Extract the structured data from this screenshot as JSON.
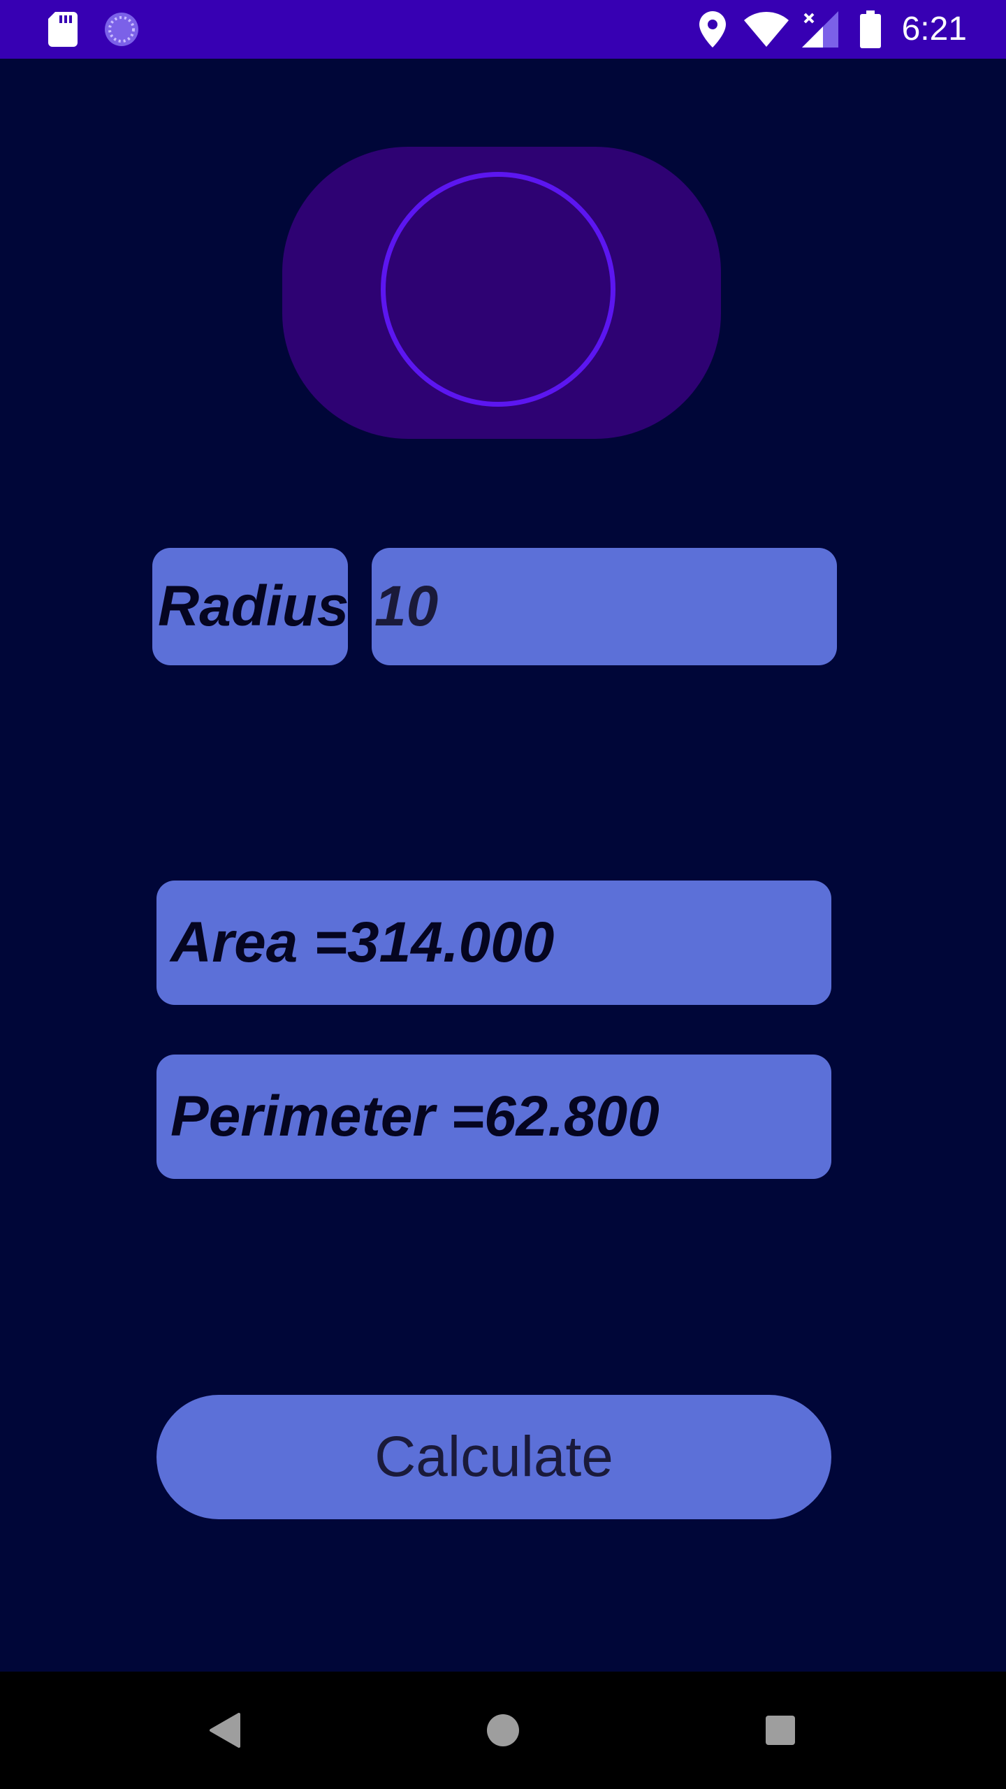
{
  "status_bar": {
    "time": "6:21",
    "left_icons": [
      "sd-card-icon",
      "sync-icon"
    ],
    "right_icons": [
      "location-icon",
      "wifi-icon",
      "cell-signal-icon",
      "battery-icon"
    ]
  },
  "logo": {
    "icon": "circle-icon"
  },
  "form": {
    "radius_label": "Radius",
    "radius_value": "10"
  },
  "results": {
    "area": "Area =314.000",
    "perimeter": "Perimeter =62.800"
  },
  "actions": {
    "calculate_label": "Calculate"
  },
  "nav_bar": {
    "buttons": [
      "back-icon",
      "home-icon",
      "recents-icon"
    ]
  },
  "colors": {
    "status_bar": "#3700b3",
    "background": "#000638",
    "accent": "#5c70d8",
    "logo_bg": "#2e0273",
    "logo_ring": "#5c16f0"
  }
}
